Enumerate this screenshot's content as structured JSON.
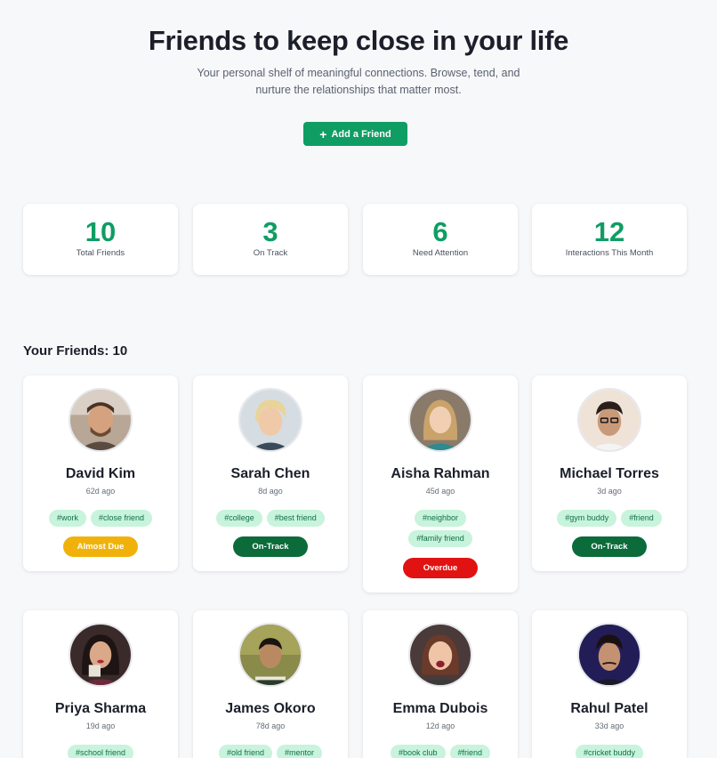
{
  "header": {
    "title": "Friends to keep close in your life",
    "subtitle": "Your personal shelf of meaningful connections. Browse, tend, and nurture the relationships that matter most.",
    "add_button": "Add a Friend"
  },
  "stats": [
    {
      "value": "10",
      "label": "Total Friends"
    },
    {
      "value": "3",
      "label": "On Track"
    },
    {
      "value": "6",
      "label": "Need Attention"
    },
    {
      "value": "12",
      "label": "Interactions This Month"
    }
  ],
  "section_title": "Your Friends: 10",
  "friends": [
    {
      "name": "David Kim",
      "ago": "62d ago",
      "tags": [
        "#work",
        "#close friend"
      ],
      "status": "Almost Due"
    },
    {
      "name": "Sarah Chen",
      "ago": "8d ago",
      "tags": [
        "#college",
        "#best friend"
      ],
      "status": "On-Track"
    },
    {
      "name": "Aisha Rahman",
      "ago": "45d ago",
      "tags": [
        "#neighbor",
        "#family friend"
      ],
      "status": "Overdue"
    },
    {
      "name": "Michael Torres",
      "ago": "3d ago",
      "tags": [
        "#gym buddy",
        "#friend"
      ],
      "status": "On-Track"
    },
    {
      "name": "Priya Sharma",
      "ago": "19d ago",
      "tags": [
        "#school friend"
      ]
    },
    {
      "name": "James Okoro",
      "ago": "78d ago",
      "tags": [
        "#old friend",
        "#mentor"
      ]
    },
    {
      "name": "Emma Dubois",
      "ago": "12d ago",
      "tags": [
        "#book club",
        "#friend"
      ]
    },
    {
      "name": "Rahul Patel",
      "ago": "33d ago",
      "tags": [
        "#cricket buddy"
      ]
    }
  ],
  "colors": {
    "accent": "#0f9d63",
    "almost_due": "#f0b20a",
    "on_track": "#0b6b3a",
    "overdue": "#e11212",
    "tag_bg": "#c8f3dc"
  }
}
